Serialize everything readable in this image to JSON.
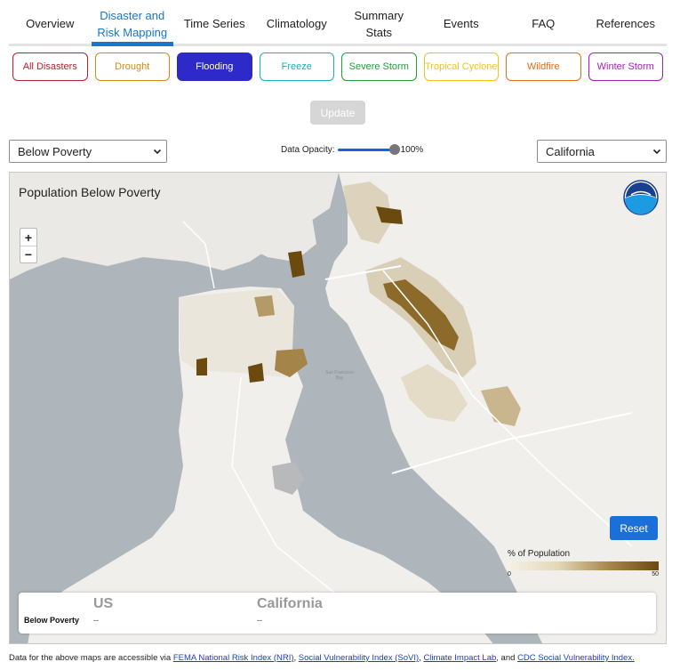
{
  "nav": {
    "tabs": [
      {
        "label": "Overview"
      },
      {
        "label": "Disaster and Risk Mapping",
        "active": true
      },
      {
        "label": "Time Series"
      },
      {
        "label": "Climatology"
      },
      {
        "label": "Summary Stats"
      },
      {
        "label": "Events"
      },
      {
        "label": "FAQ"
      },
      {
        "label": "References"
      }
    ]
  },
  "disasters": [
    {
      "label": "All Disasters",
      "color": "#b2242e"
    },
    {
      "label": "Drought",
      "color": "#d08a16"
    },
    {
      "label": "Flooding",
      "color": "#2d2ac9",
      "selected": true
    },
    {
      "label": "Freeze",
      "color": "#1bb0b9"
    },
    {
      "label": "Severe Storm",
      "color": "#1f9e3b"
    },
    {
      "label": "Tropical Cyclone",
      "color": "#f2c21b"
    },
    {
      "label": "Wildfire",
      "color": "#e46c12"
    },
    {
      "label": "Winter Storm",
      "color": "#a51fb7"
    }
  ],
  "update_label": "Update",
  "variable_select": {
    "value": "Below Poverty"
  },
  "opacity": {
    "label": "Data Opacity:",
    "value_text": "100%",
    "value": 1.0
  },
  "region_select": {
    "value": "California"
  },
  "map": {
    "title": "Population Below Poverty",
    "zoom_in": "+",
    "zoom_out": "−",
    "bay_label_line1": "San Francisco",
    "bay_label_line2": "Bay",
    "reset_label": "Reset",
    "legend": {
      "title": "% of Population",
      "min": "0",
      "max": "50"
    },
    "stats": {
      "col1_head": "US",
      "col2_head": "California",
      "row_label": "Below Poverty",
      "col1_value": "--",
      "col2_value": "--"
    },
    "colors": {
      "water": "#aeb6bb",
      "land": "#f1efeb",
      "dark": "#6b4a10"
    }
  },
  "footer": {
    "prefix": "Data for the above maps are accessible via ",
    "link1": "FEMA National Risk Index (NRI)",
    "sep1": ", ",
    "link2": "Social Vulnerability Index (SoVI)",
    "sep2": ", ",
    "link3": "Climate Impact Lab",
    "sep3": ", and ",
    "link4": "CDC Social Vulnerability Index."
  }
}
